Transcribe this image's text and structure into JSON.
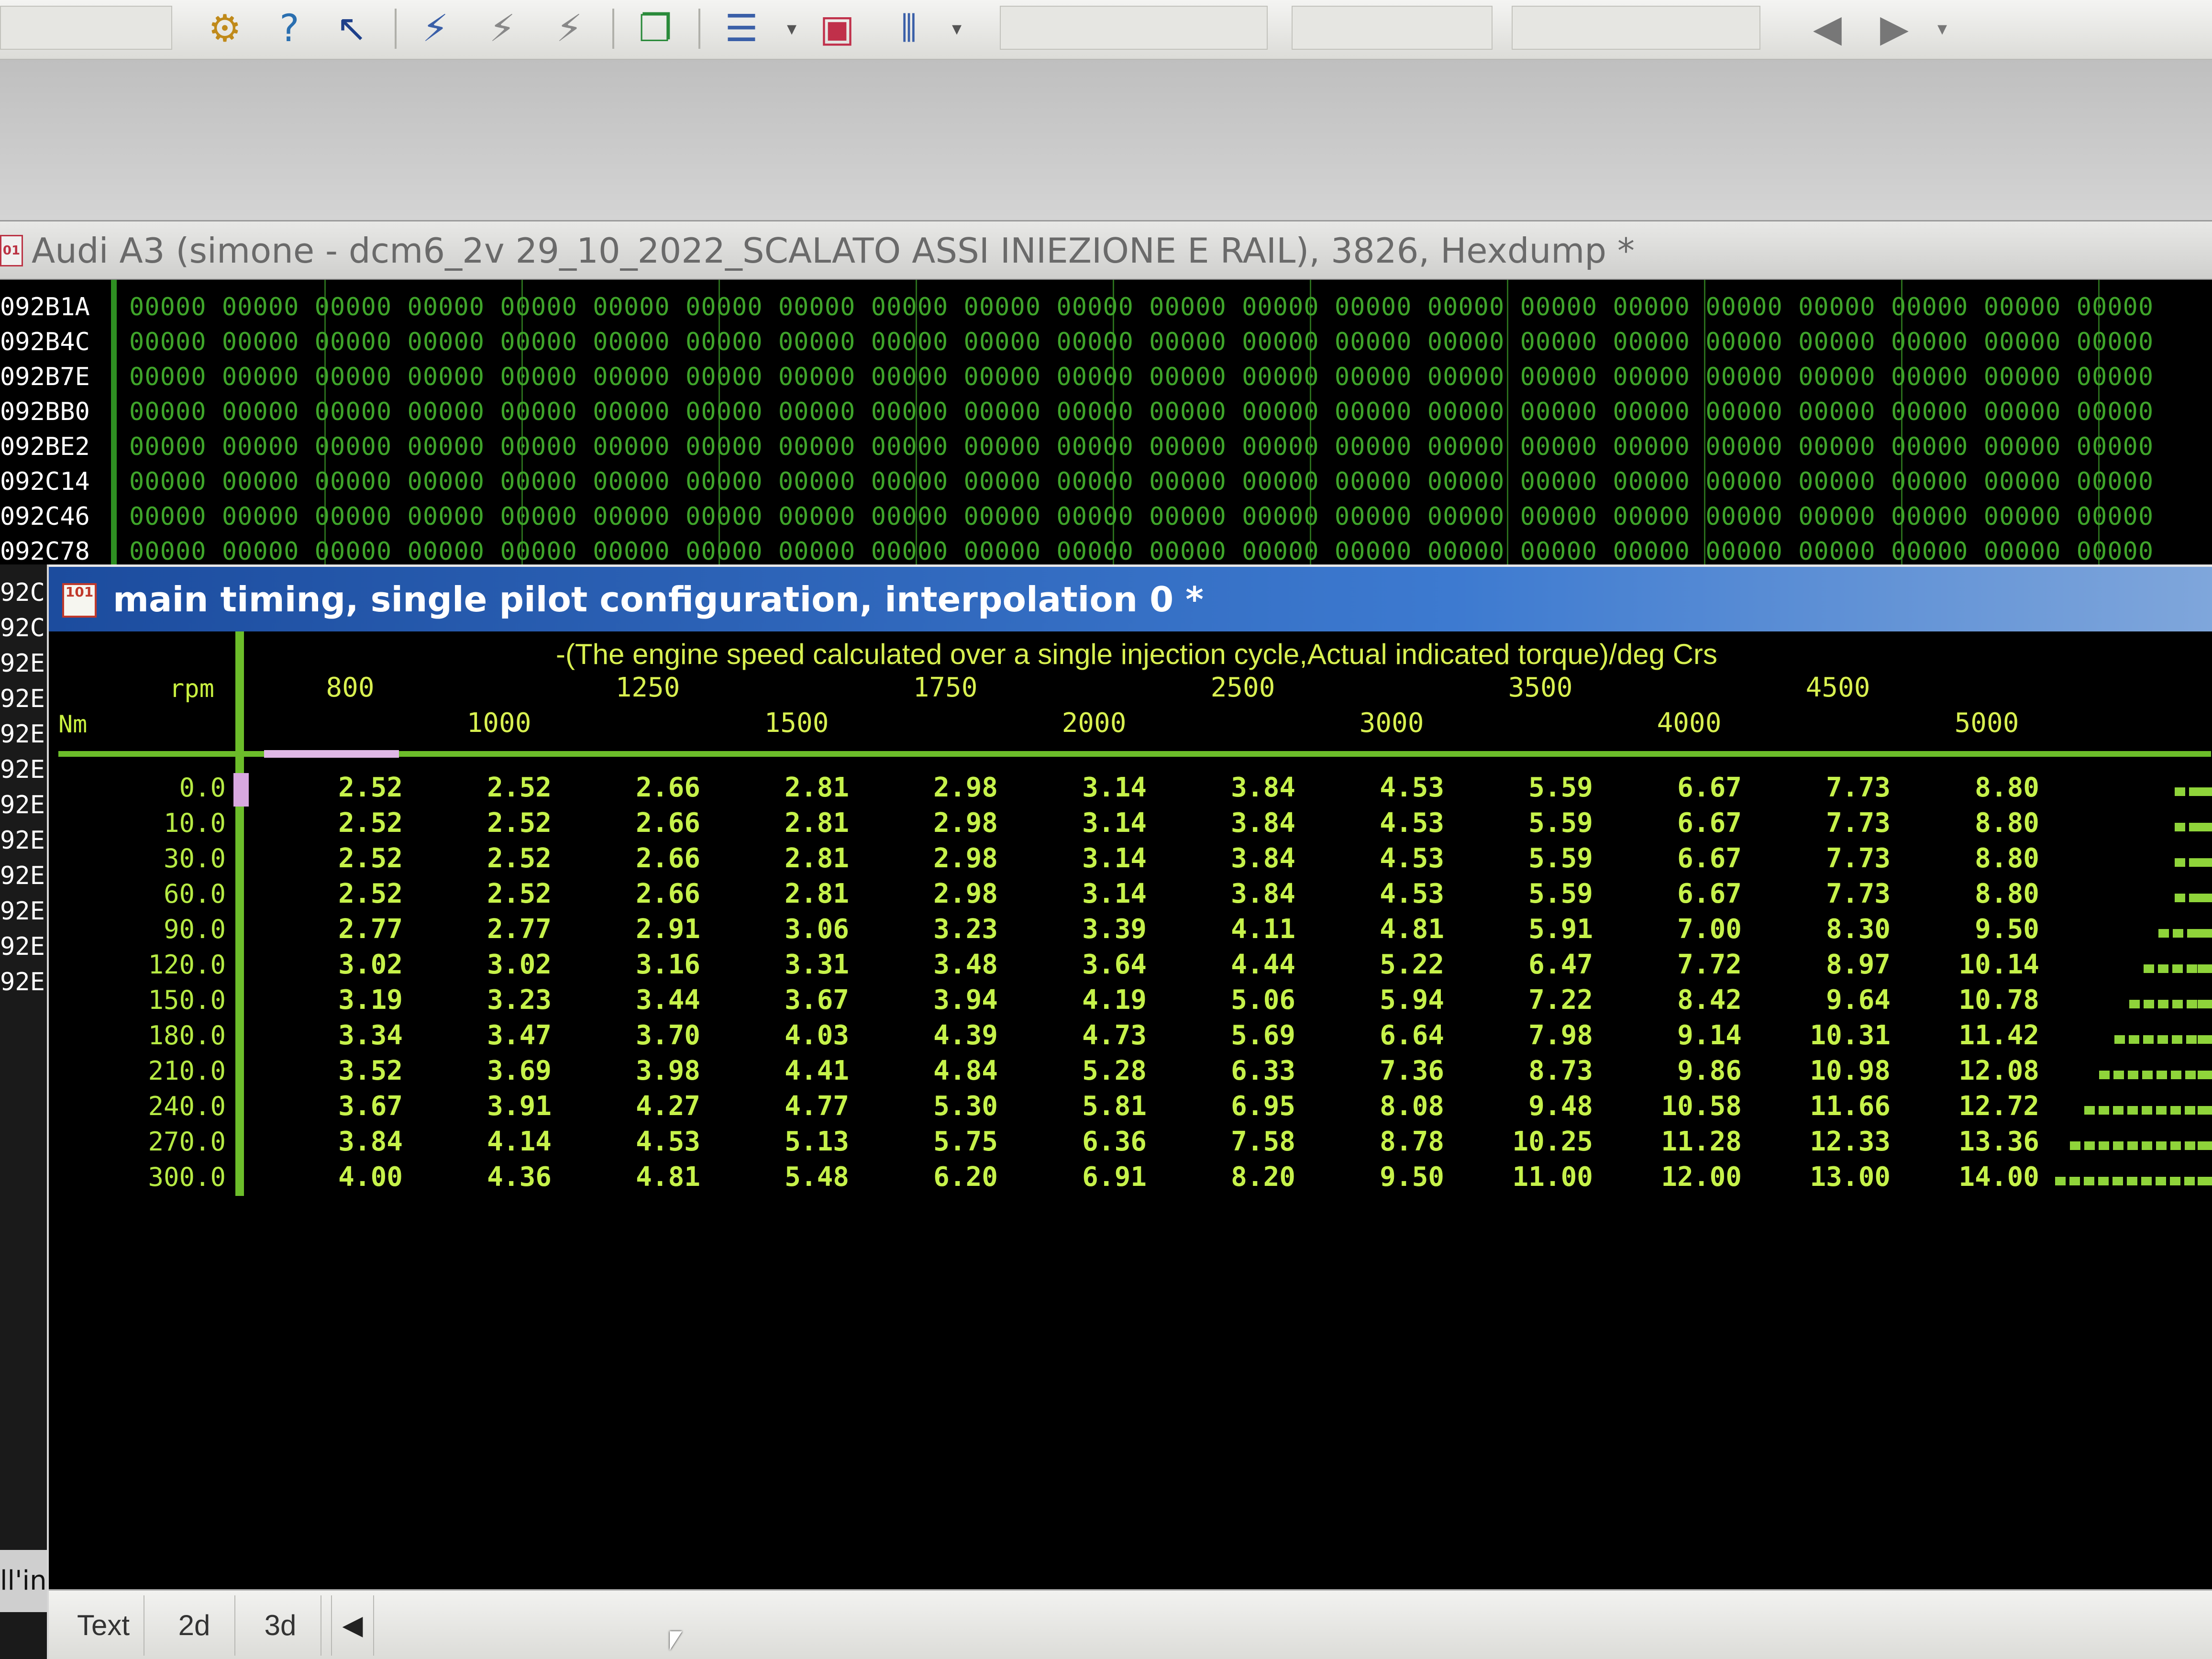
{
  "toolbar": {
    "icons": [
      "tools-icon",
      "help-icon",
      "context-help-icon",
      "chart-wand-icon",
      "chart-wand-gray-icon",
      "chart-wand-gray-2-icon",
      "windows-icon",
      "numbering-icon",
      "window-red-icon",
      "split-icon",
      "arrow-left-icon",
      "arrow-right-icon"
    ]
  },
  "hex_window": {
    "title": "Audi A3 (simone - dcm6_2v 29_10_2022_SCALATO ASSI INIEZIONE E RAIL), 3826, Hexdump *",
    "addresses": [
      "092B1A",
      "092B4C",
      "092B7E",
      "092BB0",
      "092BE2",
      "092C14",
      "092C46",
      "092C78"
    ],
    "cell_value": "00000"
  },
  "left_strip": {
    "labels": [
      "92C",
      "92C",
      "92E",
      "92E",
      "92E",
      "92E",
      "92E",
      "92E",
      "92E",
      "92E",
      "92E",
      "92E"
    ],
    "partial_text": "ll'in"
  },
  "map_window": {
    "title": "main timing, single pilot configuration, interpolation 0 *",
    "x_axis_title": "-(The engine speed calculated over a single injection cycle,Actual indicated torque)/deg Crs",
    "x_axis_unit": "rpm",
    "y_axis_unit": "Nm",
    "columns": [
      "800",
      "1000",
      "1250",
      "1500",
      "1750",
      "2000",
      "2500",
      "3000",
      "3500",
      "4000",
      "4500",
      "5000"
    ],
    "rows": [
      "0.0",
      "10.0",
      "30.0",
      "60.0",
      "90.0",
      "120.0",
      "150.0",
      "180.0",
      "210.0",
      "240.0",
      "270.0",
      "300.0"
    ],
    "values": [
      [
        "2.52",
        "2.52",
        "2.66",
        "2.81",
        "2.98",
        "3.14",
        "3.84",
        "4.53",
        "5.59",
        "6.67",
        "7.73",
        "8.80"
      ],
      [
        "2.52",
        "2.52",
        "2.66",
        "2.81",
        "2.98",
        "3.14",
        "3.84",
        "4.53",
        "5.59",
        "6.67",
        "7.73",
        "8.80"
      ],
      [
        "2.52",
        "2.52",
        "2.66",
        "2.81",
        "2.98",
        "3.14",
        "3.84",
        "4.53",
        "5.59",
        "6.67",
        "7.73",
        "8.80"
      ],
      [
        "2.52",
        "2.52",
        "2.66",
        "2.81",
        "2.98",
        "3.14",
        "3.84",
        "4.53",
        "5.59",
        "6.67",
        "7.73",
        "8.80"
      ],
      [
        "2.77",
        "2.77",
        "2.91",
        "3.06",
        "3.23",
        "3.39",
        "4.11",
        "4.81",
        "5.91",
        "7.00",
        "8.30",
        "9.50"
      ],
      [
        "3.02",
        "3.02",
        "3.16",
        "3.31",
        "3.48",
        "3.64",
        "4.44",
        "5.22",
        "6.47",
        "7.72",
        "8.97",
        "10.14"
      ],
      [
        "3.19",
        "3.23",
        "3.44",
        "3.67",
        "3.94",
        "4.19",
        "5.06",
        "5.94",
        "7.22",
        "8.42",
        "9.64",
        "10.78"
      ],
      [
        "3.34",
        "3.47",
        "3.70",
        "4.03",
        "4.39",
        "4.73",
        "5.69",
        "6.64",
        "7.98",
        "9.14",
        "10.31",
        "11.42"
      ],
      [
        "3.52",
        "3.69",
        "3.98",
        "4.41",
        "4.84",
        "5.28",
        "6.33",
        "7.36",
        "8.73",
        "9.86",
        "10.98",
        "12.08"
      ],
      [
        "3.67",
        "3.91",
        "4.27",
        "4.77",
        "5.30",
        "5.81",
        "6.95",
        "8.08",
        "9.48",
        "10.58",
        "11.66",
        "12.72"
      ],
      [
        "3.84",
        "4.14",
        "4.53",
        "5.13",
        "5.75",
        "6.36",
        "7.58",
        "8.78",
        "10.25",
        "11.28",
        "12.33",
        "13.36"
      ],
      [
        "4.00",
        "4.36",
        "4.81",
        "5.48",
        "6.20",
        "6.91",
        "8.20",
        "9.50",
        "11.00",
        "12.00",
        "13.00",
        "14.00"
      ]
    ],
    "tabs": [
      "Text",
      "2d",
      "3d"
    ],
    "active_tab": "Text"
  },
  "colors": {
    "map_text": "#c6f24a",
    "hex_text": "#3fa52a",
    "title_bar": "#2a5fb8",
    "background": "#000000"
  }
}
